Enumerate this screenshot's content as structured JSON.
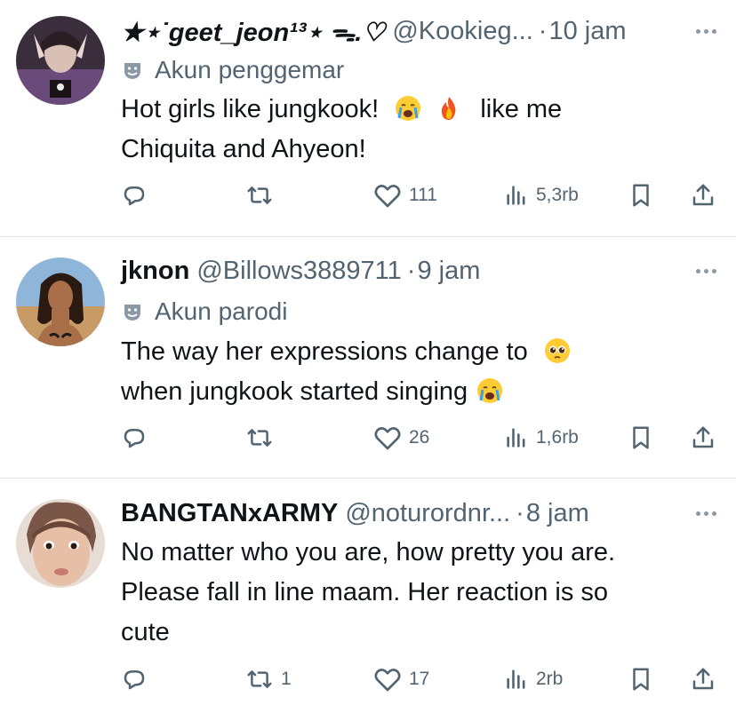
{
  "tweets": [
    {
      "name": "★⋆˙geet_jeon¹³⋆ ᯓ.♡",
      "handle": "@Kookieg...",
      "sep": "·",
      "time": "10 jam",
      "badge": "Akun penggemar",
      "text_line1_a": "Hot girls like jungkook!",
      "text_line1_b": "like me",
      "text_line2": "Chiquita and Ahyeon!",
      "replies": "",
      "retweets": "",
      "likes": "111",
      "views": "5,3rb"
    },
    {
      "name": "jknon",
      "handle": "@Billows3889711",
      "sep": "·",
      "time": "9 jam",
      "badge": "Akun parodi",
      "text_line1": "The way her expressions change to",
      "text_line2": "when jungkook started singing",
      "replies": "",
      "retweets": "",
      "likes": "26",
      "views": "1,6rb"
    },
    {
      "name": "BANGTANxARMY",
      "handle": "@noturordnr...",
      "sep": "·",
      "time": "8 jam",
      "text_line1": "No matter who you are, how pretty you are.",
      "text_line2": "Please fall in line maam. Her reaction is so",
      "text_line3": "cute",
      "replies": "",
      "retweets": "1",
      "likes": "17",
      "views": "2rb"
    }
  ],
  "icons": {
    "reply": "reply-icon",
    "retweet": "retweet-icon",
    "like": "heart-icon",
    "views": "views-icon",
    "bookmark": "bookmark-icon",
    "share": "share-icon",
    "more": "more-icon",
    "badge": "theater-mask-icon"
  },
  "colors": {
    "text": "#0f1419",
    "secondary": "#536471",
    "divider": "#e1e6ea"
  }
}
